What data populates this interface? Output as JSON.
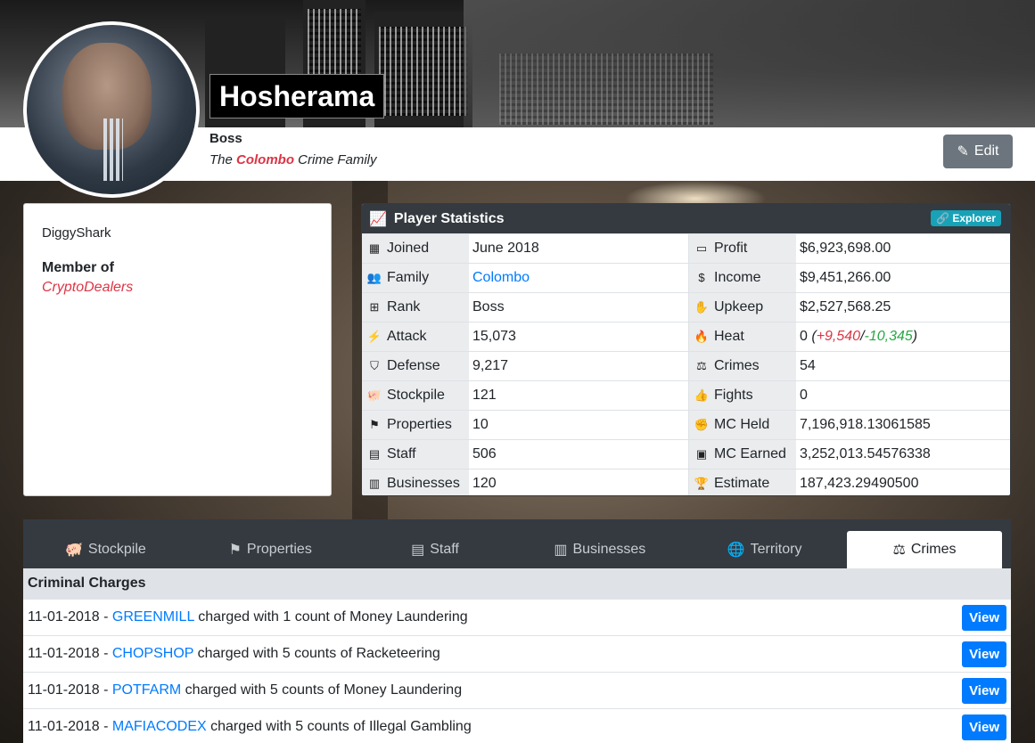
{
  "profile": {
    "name": "Hosherama",
    "rank": "Boss",
    "family_prefix": "The ",
    "family_name": "Colombo",
    "family_suffix": " Crime Family",
    "edit_label": "Edit"
  },
  "left_card": {
    "username": "DiggyShark",
    "member_label": "Member of",
    "member_value": "CryptoDealers"
  },
  "stats": {
    "title": "Player Statistics",
    "explorer_label": "Explorer",
    "rows": [
      {
        "l_icon": "calendar-icon",
        "l_label": "Joined",
        "l_value": "June 2018",
        "r_icon": "money-bill-icon",
        "r_label": "Profit",
        "r_value": "$6,923,698.00"
      },
      {
        "l_icon": "users-icon",
        "l_label": "Family",
        "l_value": "Colombo",
        "r_icon": "dollar-icon",
        "r_label": "Income",
        "r_value": "$9,451,266.00"
      },
      {
        "l_icon": "sitemap-icon",
        "l_label": "Rank",
        "l_value": "Boss",
        "r_icon": "hand-holding-icon",
        "r_label": "Upkeep",
        "r_value": "$2,527,568.25"
      },
      {
        "l_icon": "bolt-icon",
        "l_label": "Attack",
        "l_value": "15,073",
        "r_icon": "fire-icon",
        "r_label": "Heat",
        "r_value": "0"
      },
      {
        "l_icon": "shield-icon",
        "l_label": "Defense",
        "l_value": "9,217",
        "r_icon": "balance-scale-icon",
        "r_label": "Crimes",
        "r_value": "54"
      },
      {
        "l_icon": "piggy-bank-icon",
        "l_label": "Stockpile",
        "l_value": "121",
        "r_icon": "thumbs-up-icon",
        "r_label": "Fights",
        "r_value": "0"
      },
      {
        "l_icon": "flag-icon",
        "l_label": "Properties",
        "l_value": "10",
        "r_icon": "fist-icon",
        "r_label": "MC Held",
        "r_value": "7,196,918.13061585"
      },
      {
        "l_icon": "id-card-icon",
        "l_label": "Staff",
        "l_value": "506",
        "r_icon": "briefcase-icon",
        "r_label": "MC Earned",
        "r_value": "3,252,013.54576338"
      },
      {
        "l_icon": "building-icon",
        "l_label": "Businesses",
        "l_value": "120",
        "r_icon": "trophy-icon",
        "r_label": "Estimate",
        "r_value": "187,423.29490500"
      }
    ],
    "heat_detail": {
      "open": " (",
      "plus": "+9,540",
      "slash": "/",
      "minus": "-10,345",
      "close": ")"
    }
  },
  "tabs": [
    {
      "icon": "piggy-bank-icon",
      "label": "Stockpile"
    },
    {
      "icon": "flag-icon",
      "label": "Properties"
    },
    {
      "icon": "id-card-icon",
      "label": "Staff"
    },
    {
      "icon": "building-icon",
      "label": "Businesses"
    },
    {
      "icon": "globe-icon",
      "label": "Territory"
    },
    {
      "icon": "balance-scale-icon",
      "label": "Crimes",
      "active": true
    }
  ],
  "charges": {
    "title": "Criminal Charges",
    "view_label": "View",
    "items": [
      {
        "date": "11-01-2018",
        "target": "GREENMILL",
        "text": " charged with 1 count of Money Laundering"
      },
      {
        "date": "11-01-2018",
        "target": "CHOPSHOP",
        "text": " charged with 5 counts of Racketeering"
      },
      {
        "date": "11-01-2018",
        "target": "POTFARM",
        "text": " charged with 5 counts of Money Laundering"
      },
      {
        "date": "11-01-2018",
        "target": "MAFIACODEX",
        "text": " charged with 5 counts of Illegal Gambling"
      }
    ]
  }
}
